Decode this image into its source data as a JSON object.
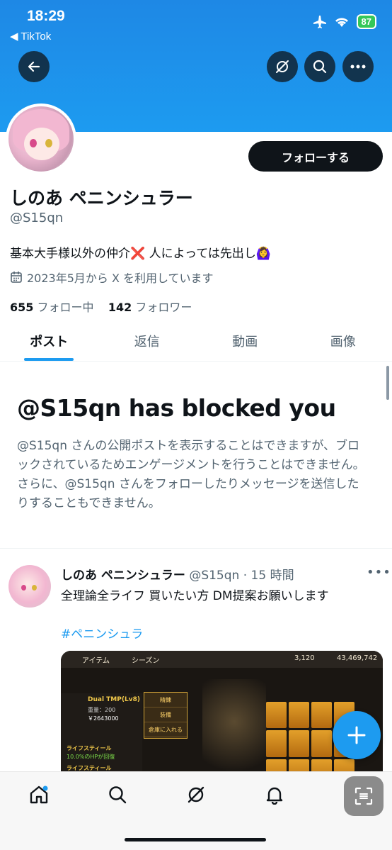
{
  "status_bar": {
    "time": "18:29",
    "back_app": "◀ TikTok",
    "battery": "87"
  },
  "profile": {
    "follow_label": "フォローする",
    "display_name": "しのあ ペニンシュラー",
    "handle": "@S15qn",
    "bio": "基本大手様以外の仲介❌ 人によっては先出し🙆‍♀️",
    "joined": "2023年5月から X を利用しています",
    "following_count": "655",
    "following_label": "フォロー中",
    "followers_count": "142",
    "followers_label": "フォロワー"
  },
  "tabs": [
    {
      "label": "ポスト"
    },
    {
      "label": "返信"
    },
    {
      "label": "動画"
    },
    {
      "label": "画像"
    }
  ],
  "blocked": {
    "title": "@S15qn has blocked you",
    "message": "@S15qn さんの公開ポストを表示することはできますが、ブロックされているためエンゲージメントを行うことはできません。さらに、@S15qn さんをフォローしたりメッセージを送信したりすることもできません。"
  },
  "post": {
    "name": "しのあ ペニンシュラー",
    "meta": "@S15qn · 15 時間",
    "text": "全理論全ライフ 買いたい方 DM提案お願いします",
    "hashtag": "#ペニンシュラ",
    "image": {
      "header_title": "アイテム",
      "season": "シーズン",
      "currency1": "3,120",
      "currency2": "43,469,742",
      "item_name": "Dual TMP(Lv8)",
      "item_weight": "重量：200",
      "item_price": "￥2643000",
      "skill1": "ライフスティール",
      "skill2": "ライフスティール",
      "pct": "10.0%のHPが回復",
      "menu": [
        "精錬",
        "装備",
        "倉庫に入れる"
      ]
    }
  },
  "colors": {
    "accent": "#1d9bf0",
    "text_primary": "#0f1419",
    "text_secondary": "#536471"
  },
  "icons": {
    "back": "arrow-left-icon",
    "grok": "grok-icon",
    "search": "search-icon",
    "more": "more-icon",
    "calendar": "calendar-icon",
    "home": "home-icon",
    "notifications": "bell-icon",
    "compose": "plus-icon",
    "scan": "scan-icon"
  }
}
